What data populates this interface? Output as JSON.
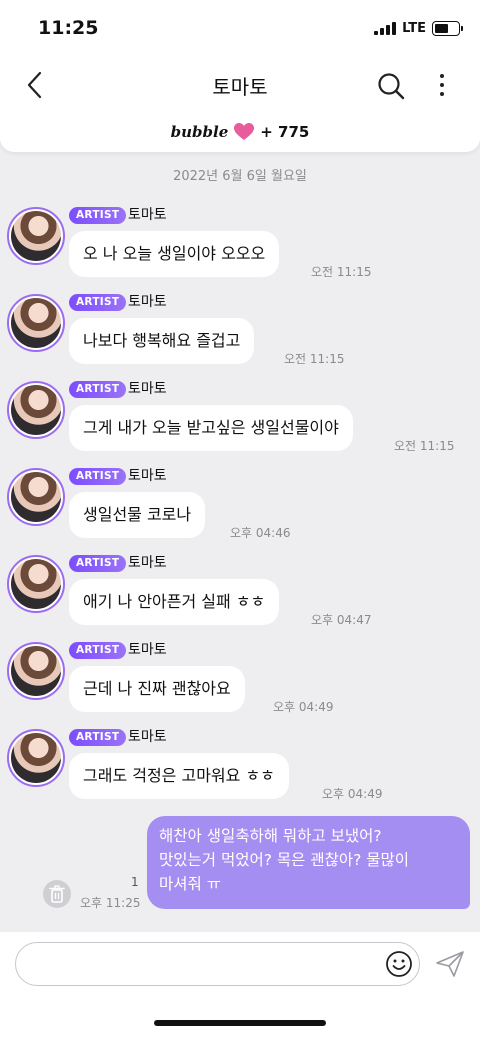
{
  "status_bar": {
    "time": "11:25",
    "network": "LTE",
    "battery_level": 0.6
  },
  "nav": {
    "title": "토마토",
    "back_icon": "chevron-left-icon",
    "search_icon": "search-icon",
    "more_icon": "more-vertical-icon"
  },
  "bubble": {
    "logo": "bubble",
    "count": "+ 775",
    "heart_color": "#e85b9c"
  },
  "date": "2022년 6월 6일 월요일",
  "messages": [
    {
      "tag": "ARTIST",
      "sender": "토마토",
      "text": "오 나 오늘 생일이야 오오오",
      "time": "오전 11:15"
    },
    {
      "tag": "ARTIST",
      "sender": "토마토",
      "text": "나보다 행복해요 즐겁고",
      "time": "오전 11:15"
    },
    {
      "tag": "ARTIST",
      "sender": "토마토",
      "text": "그게 내가 오늘 받고싶은 생일선물이야",
      "time": "오전 11:15"
    },
    {
      "tag": "ARTIST",
      "sender": "토마토",
      "text": "생일선물 코로나",
      "time": "오후 04:46"
    },
    {
      "tag": "ARTIST",
      "sender": "토마토",
      "text": "애기 나 안아픈거 실패 ㅎㅎ",
      "time": "오후 04:47"
    },
    {
      "tag": "ARTIST",
      "sender": "토마토",
      "text": "근데 나 진짜 괜찮아요",
      "time": "오후 04:49"
    },
    {
      "tag": "ARTIST",
      "sender": "토마토",
      "text": "그래도 걱정은 고마워요 ㅎㅎ",
      "time": "오후 04:49"
    }
  ],
  "sent": {
    "lines": [
      "해찬아 생일축하해 뭐하고 보냈어?",
      "맛있는거 먹었어? 목은 괜찮아? 물많이",
      "마셔줘 ㅠ"
    ],
    "read_count": "1",
    "time": "오후 11:25"
  },
  "composer": {
    "placeholder": "",
    "emoji_icon": "smiley-icon",
    "send_icon": "paper-plane-icon"
  },
  "colors": {
    "accent": "#7c4dff",
    "sent_bubble": "#a58ef2",
    "background": "#eeeef0"
  }
}
